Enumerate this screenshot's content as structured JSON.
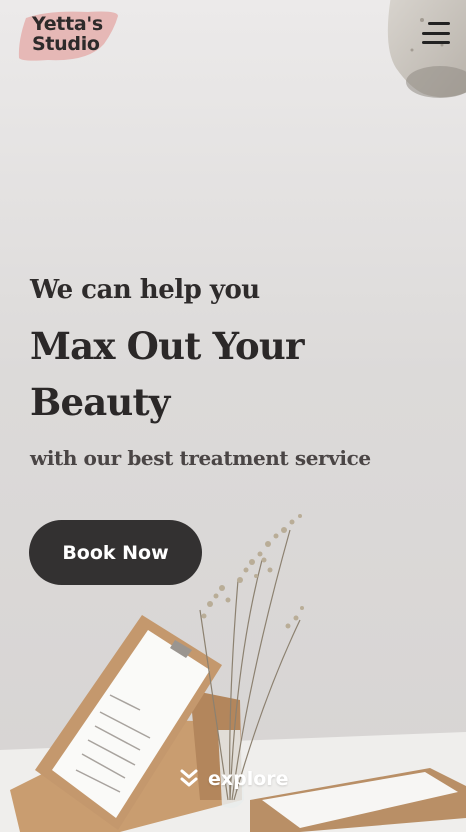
{
  "logo": {
    "line1": "Yetta's",
    "line2": "Studio",
    "blob_color": "#e6b8b6"
  },
  "hero": {
    "tagline": "We can help you",
    "headline": "Max Out Your Beauty",
    "subline": "with our best treatment service",
    "cta_label": "Book Now"
  },
  "explore": {
    "label": "explore",
    "icon": "double-chevron-down-icon"
  },
  "menu": {
    "icon": "hamburger-menu-icon"
  },
  "colors": {
    "button_bg": "#333131",
    "text_dark": "#2b2828",
    "background": "#dcdad9"
  }
}
